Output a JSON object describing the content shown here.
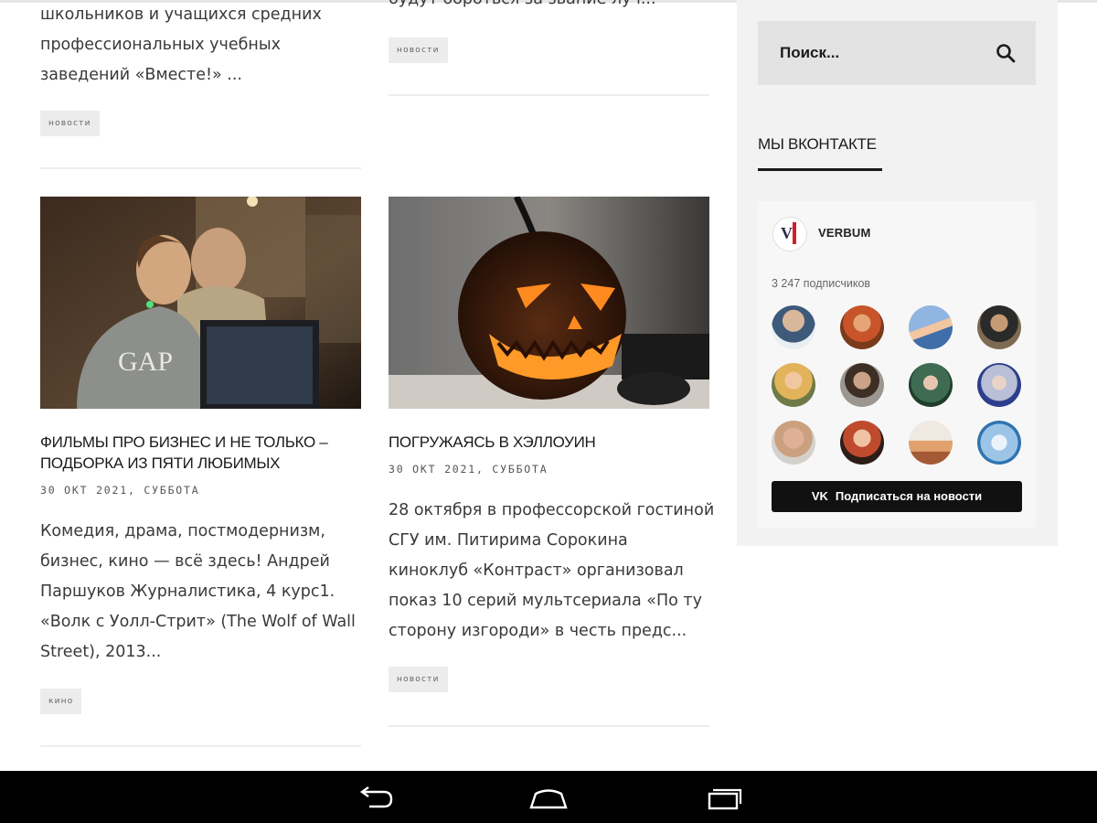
{
  "articles": {
    "left_top": {
      "excerpt_lines": [
        "школьников и учащихся средних",
        "профессиональных учебных",
        "заведений «Вместе!» ..."
      ],
      "tag": "новости"
    },
    "right_top": {
      "excerpt_lines": [
        "будут бороться за звание луч..."
      ],
      "tag": "новости"
    },
    "left_bottom": {
      "title_lines": [
        "ФИЛЬМЫ ПРО БИЗНЕС И НЕ ТОЛЬКО –",
        "ПОДБОРКА ИЗ ПЯТИ ЛЮБИМЫХ"
      ],
      "date": "30 ОКТ 2021, СУББОТА",
      "excerpt_lines": [
        "Комедия, драма, постмодернизм,",
        "бизнес, кино — всё здесь! Андрей",
        "Паршуков Журналистика, 4 курс1.",
        "«Волк с Уолл-Стрит» (The Wolf of Wall",
        "Street), 2013..."
      ],
      "tag": "кино"
    },
    "right_bottom": {
      "title": "ПОГРУЖАЯСЬ В ХЭЛЛОУИН",
      "date": "30 ОКТ 2021, СУББОТА",
      "excerpt_lines": [
        "28 октября в профессорской гостиной",
        "СГУ им. Питирима Сорокина",
        "киноклуб «Контраст» организовал",
        "показ 10 серий мультсериала «По ту",
        "сторону изгороди» в честь предс..."
      ],
      "tag": "новости"
    }
  },
  "sidebar": {
    "search_placeholder": "Поиск...",
    "widget_title": "МЫ ВКОНТАКТЕ",
    "vk": {
      "group_name": "VERBUM",
      "subscribers": "3 247 подписчиков",
      "subscribe_button": "Подписаться на новости",
      "logo_text": "VI"
    }
  },
  "colors": {
    "sidebar_bg": "#f2f2f2",
    "search_bg": "#e3e3e3",
    "button_bg": "#111111",
    "tag_bg": "#ececec"
  },
  "icons": {
    "search": "search-icon",
    "back": "back-icon",
    "home": "home-icon",
    "recents": "recents-icon"
  }
}
